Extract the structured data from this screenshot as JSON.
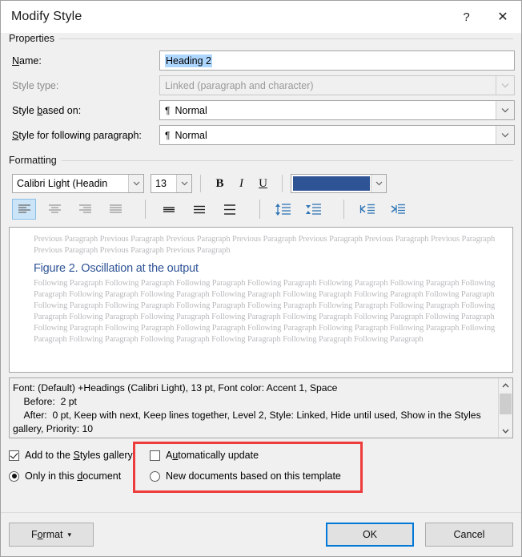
{
  "window": {
    "title": "Modify Style",
    "help_label": "?",
    "close_label": "✕"
  },
  "properties": {
    "group_label": "Properties",
    "name": {
      "label": "Name:",
      "value": "Heading 2"
    },
    "style_type": {
      "label": "Style type:",
      "value": "Linked (paragraph and character)",
      "disabled": true
    },
    "style_based_on": {
      "label": "Style based on:",
      "marker": "¶",
      "value": "Normal"
    },
    "style_following": {
      "label": "Style for following paragraph:",
      "marker": "¶",
      "value": "Normal"
    }
  },
  "formatting": {
    "group_label": "Formatting",
    "font_family": "Calibri Light (Headin",
    "font_size": "13",
    "bold_label": "B",
    "italic_label": "I",
    "underline_label": "U",
    "font_color": "#2F5496",
    "align_left_label": "Align Left",
    "align_center_label": "Center",
    "align_right_label": "Align Right",
    "align_justify_label": "Justify",
    "spacing_single_label": "Single Spacing",
    "spacing_one_half_label": "1.5 Spacing",
    "spacing_double_label": "Double Spacing",
    "line_spacing_label": "Line Spacing",
    "paragraph_spacing_label": "Paragraph Spacing",
    "decrease_indent_label": "Decrease Indent",
    "increase_indent_label": "Increase Indent"
  },
  "preview": {
    "previous_paragraph": "Previous Paragraph Previous Paragraph Previous Paragraph Previous Paragraph Previous Paragraph Previous Paragraph Previous Paragraph Previous Paragraph Previous Paragraph Previous Paragraph",
    "sample_heading": "Figure 2. Oscillation at the output",
    "sample_heading_color": "#2F5496",
    "following_paragraph": "Following Paragraph Following Paragraph Following Paragraph Following Paragraph Following Paragraph Following Paragraph Following Paragraph Following Paragraph Following Paragraph Following Paragraph Following Paragraph Following Paragraph Following Paragraph Following Paragraph Following Paragraph Following Paragraph Following Paragraph Following Paragraph Following Paragraph Following Paragraph Following Paragraph Following Paragraph Following Paragraph Following Paragraph Following Paragraph Following Paragraph Following Paragraph Following Paragraph Following Paragraph Following Paragraph Following Paragraph Following Paragraph Following Paragraph Following Paragraph Following Paragraph Following Paragraph Following Paragraph Following Paragraph"
  },
  "description": {
    "text": "Font: (Default) +Headings (Calibri Light), 13 pt, Font color: Accent 1, Space\n    Before:  2 pt\n    After:  0 pt, Keep with next, Keep lines together, Level 2, Style: Linked, Hide until used, Show in the Styles gallery, Priority: 10",
    "scroll_up_label": "▲",
    "scroll_down_label": "▼"
  },
  "options": {
    "add_to_gallery": {
      "label": "Add to the Styles gallery",
      "checked": true
    },
    "automatically_update": {
      "label": "Automatically update",
      "checked": false
    },
    "only_this_document": {
      "label": "Only in this document",
      "selected": true
    },
    "new_documents_template": {
      "label": "New documents based on this template",
      "selected": false
    },
    "highlight_color": "#EE3B3B"
  },
  "footer": {
    "format_label": "Format",
    "format_caret": "▾",
    "ok_label": "OK",
    "cancel_label": "Cancel"
  }
}
